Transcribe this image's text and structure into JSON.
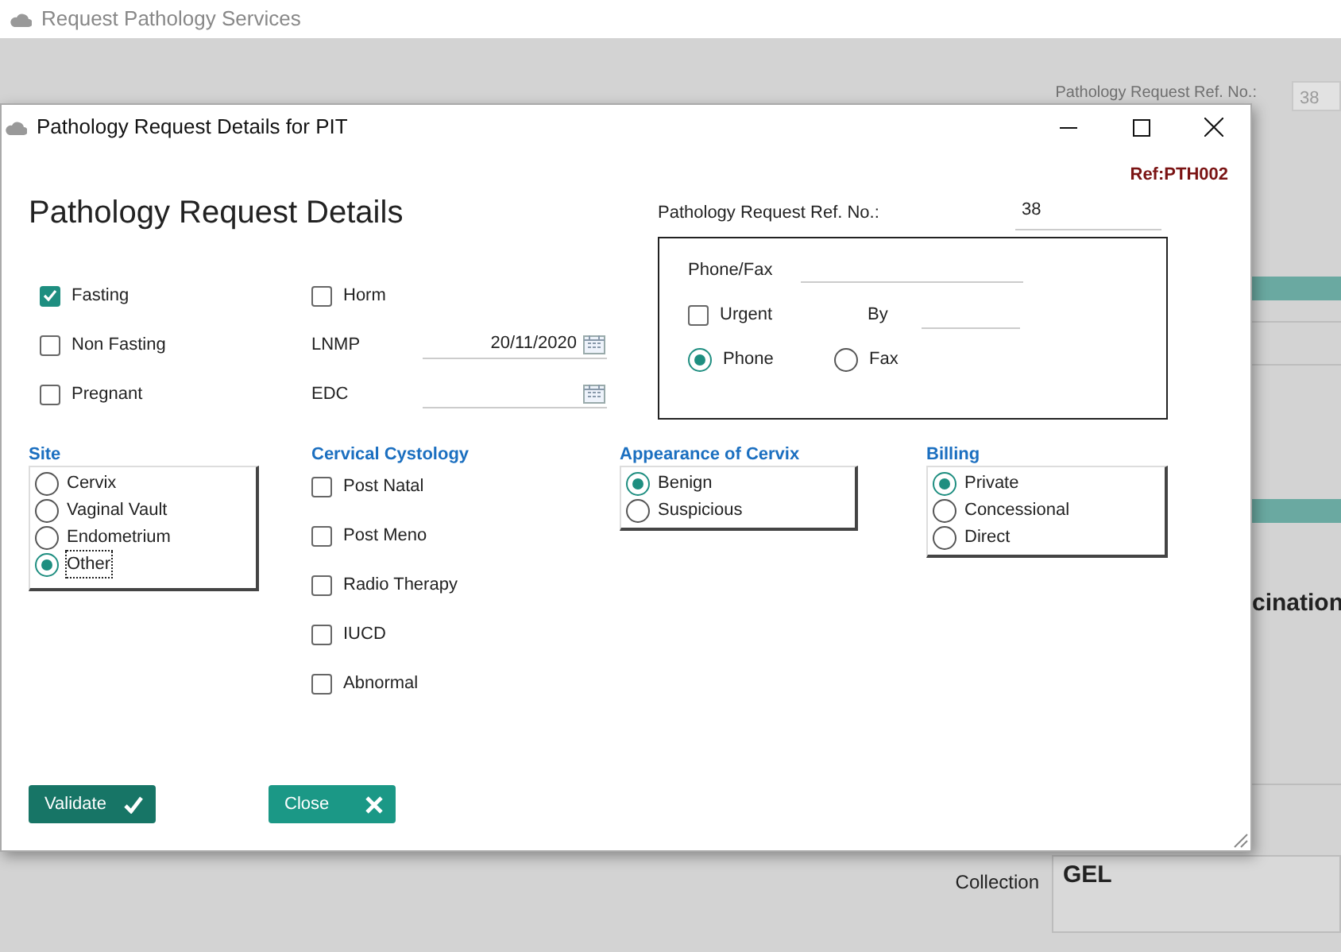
{
  "app": {
    "title": "Request Pathology Services"
  },
  "background": {
    "ref_label": "Pathology Request Ref. No.:",
    "ref_value": "38",
    "heading_fragment": "cination",
    "collection_label": "Collection",
    "collection_value": "GEL"
  },
  "dialog": {
    "title": "Pathology Request Details for PIT",
    "ref_code": "Ref:PTH002",
    "heading": "Pathology Request Details",
    "ref_no": {
      "label": "Pathology Request Ref. No.:",
      "value": "38"
    },
    "conditions": [
      {
        "label": "Fasting",
        "checked": true
      },
      {
        "label": "Non Fasting",
        "checked": false
      },
      {
        "label": "Pregnant",
        "checked": false
      }
    ],
    "middle": [
      {
        "kind": "checkbox",
        "label": "Horm",
        "checked": false
      },
      {
        "kind": "date",
        "label": "LNMP",
        "value": "20/11/2020"
      },
      {
        "kind": "date",
        "label": "EDC"
      }
    ],
    "contact": {
      "phone_fax_label": "Phone/Fax",
      "urgent": {
        "label": "Urgent",
        "checked": false
      },
      "by_label": "By",
      "methods": [
        {
          "label": "Phone",
          "selected": true
        },
        {
          "label": "Fax",
          "selected": false
        }
      ]
    },
    "groups": [
      {
        "kind": "radio",
        "title": "Site",
        "items": [
          {
            "label": "Cervix",
            "selected": false,
            "focused": false
          },
          {
            "label": "Vaginal Vault",
            "selected": false,
            "focused": false
          },
          {
            "label": "Endometrium",
            "selected": false,
            "focused": false
          },
          {
            "label": "Other",
            "selected": true,
            "focused": true
          }
        ]
      },
      {
        "kind": "checkbox",
        "title": "Cervical Cystology",
        "items": [
          {
            "label": "Post Natal",
            "checked": false
          },
          {
            "label": "Post Meno",
            "checked": false
          },
          {
            "label": "Radio Therapy",
            "checked": false
          },
          {
            "label": "IUCD",
            "checked": false
          },
          {
            "label": "Abnormal",
            "checked": false
          }
        ]
      },
      {
        "kind": "radio",
        "title": "Appearance of Cervix",
        "items": [
          {
            "label": "Benign",
            "selected": true
          },
          {
            "label": "Suspicious",
            "selected": false
          }
        ]
      },
      {
        "kind": "radio",
        "title": "Billing",
        "items": [
          {
            "label": "Private",
            "selected": true
          },
          {
            "label": "Concessional",
            "selected": false
          },
          {
            "label": "Direct",
            "selected": false
          }
        ]
      }
    ],
    "buttons": [
      {
        "kind": "validate",
        "label": "Validate"
      },
      {
        "kind": "close",
        "label": "Close"
      }
    ]
  }
}
